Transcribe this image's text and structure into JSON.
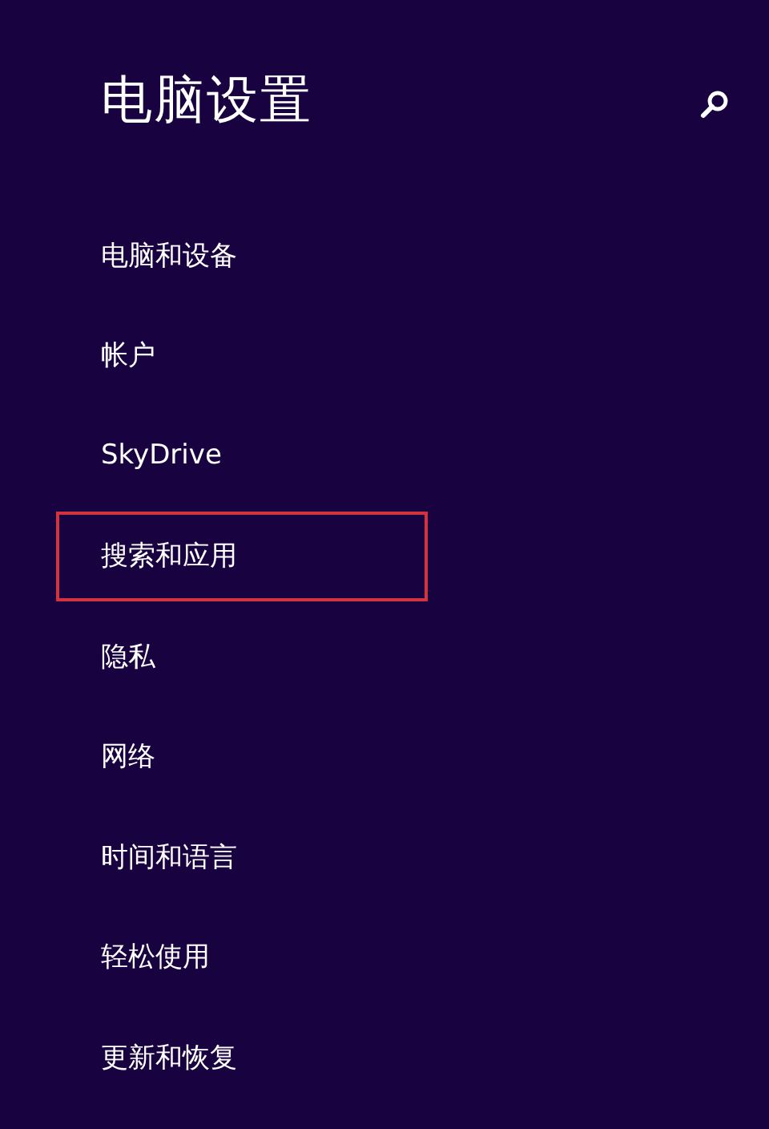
{
  "title": "电脑设置",
  "items": [
    {
      "label": "电脑和设备",
      "highlighted": false
    },
    {
      "label": "帐户",
      "highlighted": false
    },
    {
      "label": "SkyDrive",
      "highlighted": false
    },
    {
      "label": "搜索和应用",
      "highlighted": true
    },
    {
      "label": "隐私",
      "highlighted": false
    },
    {
      "label": "网络",
      "highlighted": false
    },
    {
      "label": "时间和语言",
      "highlighted": false
    },
    {
      "label": "轻松使用",
      "highlighted": false
    },
    {
      "label": "更新和恢复",
      "highlighted": false
    }
  ]
}
